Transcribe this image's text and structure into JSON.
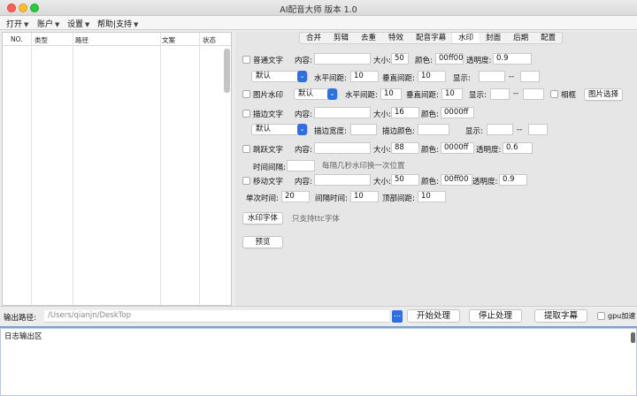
{
  "window": {
    "title": "AI配音大师  版本 1.0"
  },
  "menu": [
    {
      "label": "打开"
    },
    {
      "label": "账户"
    },
    {
      "label": "设置"
    },
    {
      "label": "帮助|支持"
    }
  ],
  "table": {
    "columns": [
      "NO.",
      "类型",
      "路径",
      "文案",
      "状态"
    ]
  },
  "tabs": [
    "合并",
    "剪辑",
    "去重",
    "特效",
    "配音字幕",
    "水印",
    "封面",
    "后期",
    "配置"
  ],
  "active_tab": "水印",
  "watermark": {
    "text_wm": {
      "label": "普通文字",
      "content_label": "内容:",
      "content": "",
      "size_label": "大小:",
      "size": "50",
      "color_label": "颜色:",
      "color": "00ff00",
      "opacity_label": "透明度:",
      "opacity": "0.9",
      "position": "默认",
      "hspace_label": "水平间距:",
      "hspace": "10",
      "vspace_label": "垂直间距:",
      "vspace": "10",
      "display_label": "显示:",
      "display_from": "",
      "dash": "--",
      "display_to": ""
    },
    "img_wm": {
      "label": "图片水印",
      "position": "默认",
      "hspace_label": "水平间距:",
      "hspace": "10",
      "vspace_label": "垂直间距:",
      "vspace": "10",
      "display_label": "显示:",
      "display_from": "",
      "dash": "--",
      "display_to": "",
      "frame_label": "相框",
      "choose_button": "图片选择"
    },
    "stroke_text": {
      "label": "描边文字",
      "content_label": "内容:",
      "content": "",
      "size_label": "大小:",
      "size": "16",
      "color_label": "颜色:",
      "color": "0000ff",
      "position": "默认",
      "stroke_width_label": "描边宽度:",
      "stroke_width": "",
      "stroke_color_label": "描边颜色:",
      "stroke_color": "",
      "display_label": "显示:",
      "display_from": "",
      "dash": "--",
      "display_to": ""
    },
    "jump_text": {
      "label": "跳跃文字",
      "content_label": "内容:",
      "content": "",
      "size_label": "大小:",
      "size": "88",
      "color_label": "颜色:",
      "color": "0000ff",
      "opacity_label": "透明度:",
      "opacity": "0.6",
      "interval_label": "时间间隔:",
      "interval": "",
      "interval_hint": "每隔几秒水印换一次位置"
    },
    "moving_text": {
      "label": "移动文字",
      "content_label": "内容:",
      "content": "",
      "size_label": "大小:",
      "size": "50",
      "color_label": "颜色:",
      "color": "00ff00",
      "opacity_label": "透明度:",
      "opacity": "0.9",
      "once_label": "单次时间:",
      "once": "20",
      "gap_label": "间隔时间:",
      "gap": "10",
      "top_label": "顶部间距:",
      "top": "10"
    },
    "font_button": "水印字体",
    "font_hint": "只支持ttc字体",
    "preview_button": "预览"
  },
  "output": {
    "label": "输出路径:",
    "path": "/Users/qianjn/DeskTop",
    "browse": "...",
    "start_button": "开始处理",
    "stop_button": "停止处理",
    "extract_button": "提取字幕",
    "gpu_label": "gpu加速"
  },
  "log": {
    "title": "日志输出区"
  }
}
